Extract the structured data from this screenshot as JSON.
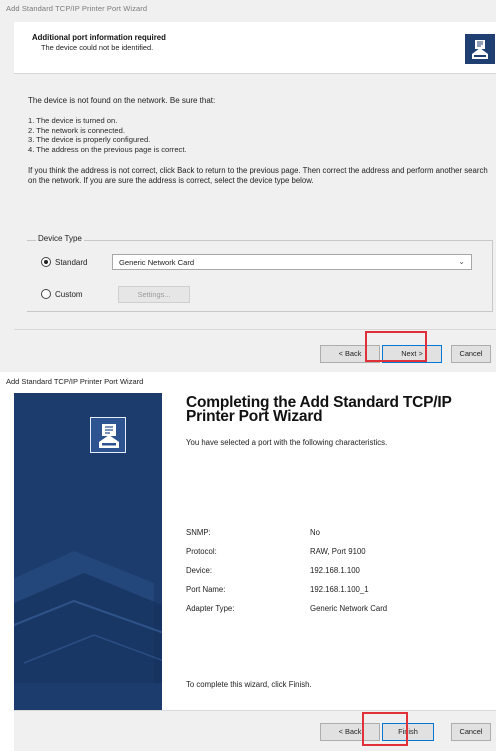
{
  "wizard1": {
    "window_title": "Add Standard TCP/IP Printer Port Wizard",
    "header_title": "Additional port information required",
    "header_subtitle": "The device could not be identified.",
    "intro": "The device is not found on the network.  Be sure that:",
    "checklist": [
      "1.  The device is turned on.",
      "2.  The network is connected.",
      "3.  The device is properly configured.",
      "4.  The address on the previous page is correct."
    ],
    "instructions": "If you think the address is not correct, click Back to return to the previous page.  Then correct the address and perform another search on the network.  If you are sure the address is correct, select the device type below.",
    "device_type_label": "Device Type",
    "standard_label": "Standard",
    "standard_selected": true,
    "device_type_value": "Generic Network Card",
    "custom_label": "Custom",
    "settings_label": "Settings...",
    "back_label": "< Back",
    "next_label": "Next >",
    "cancel_label": "Cancel",
    "icon": "printer-wizard-icon"
  },
  "wizard2": {
    "window_title": "Add Standard TCP/IP Printer Port Wizard",
    "title": "Completing the Add Standard TCP/IP Printer Port Wizard",
    "description": "You have selected a port with the following characteristics.",
    "properties": [
      {
        "key": "SNMP:",
        "value": "No"
      },
      {
        "key": "Protocol:",
        "value": "RAW, Port 9100"
      },
      {
        "key": "Device:",
        "value": "192.168.1.100"
      },
      {
        "key": "Port Name:",
        "value": "192.168.1.100_1"
      },
      {
        "key": "Adapter Type:",
        "value": "Generic Network Card"
      }
    ],
    "footnote": "To complete this wizard, click Finish.",
    "back_label": "< Back",
    "finish_label": "Finish",
    "cancel_label": "Cancel",
    "sidebar_color": "#1c3c6e",
    "icon": "printer-wizard-icon"
  },
  "highlight_color": "#e0303a"
}
